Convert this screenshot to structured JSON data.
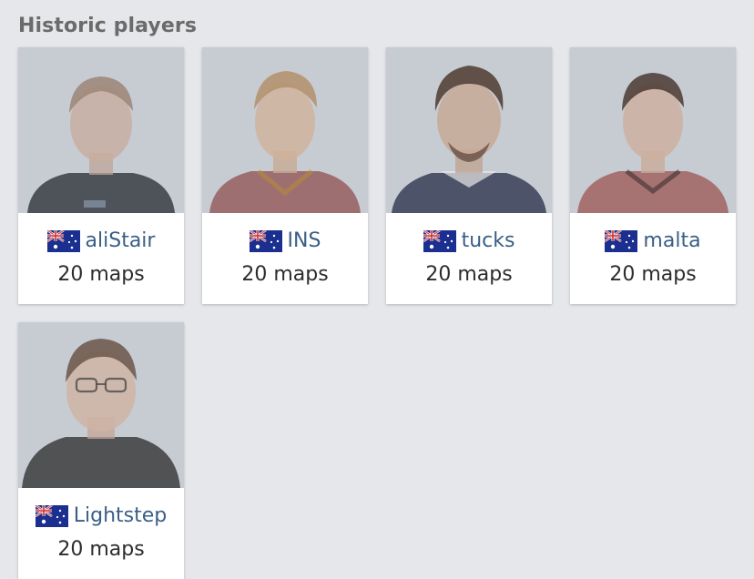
{
  "section": {
    "title": "Historic players"
  },
  "players": [
    {
      "name": "aliStair",
      "country_flag": "australia-flag",
      "maps": "20 maps",
      "jersey_color": "#1e2128"
    },
    {
      "name": "INS",
      "country_flag": "australia-flag",
      "maps": "20 maps",
      "jersey_color": "#7c2420"
    },
    {
      "name": "tucks",
      "country_flag": "australia-flag",
      "maps": "20 maps",
      "jersey_color": "#1f2640"
    },
    {
      "name": "malta",
      "country_flag": "australia-flag",
      "maps": "20 maps",
      "jersey_color": "#8a2a22"
    },
    {
      "name": "Lightstep",
      "country_flag": "australia-flag",
      "maps": "20 maps",
      "jersey_color": "#232323"
    }
  ],
  "colors": {
    "background": "#e6e7eb",
    "link": "#3a5f86",
    "title": "#6b6b6b",
    "card": "#ffffff"
  }
}
